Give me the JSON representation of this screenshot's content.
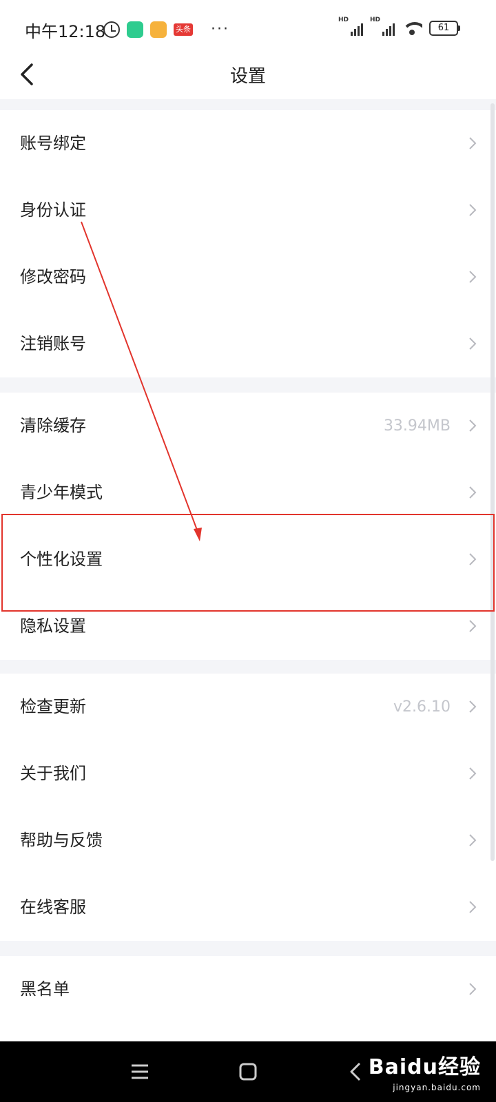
{
  "status_bar": {
    "time": "中午12:18",
    "toutiao_badge": "头条",
    "more": "···",
    "signal_1_label": "HD",
    "signal_2_label": "HD",
    "battery": "61"
  },
  "header": {
    "title": "设置"
  },
  "sections": [
    {
      "items": [
        {
          "label": "账号绑定",
          "value": ""
        },
        {
          "label": "身份认证",
          "value": ""
        },
        {
          "label": "修改密码",
          "value": ""
        },
        {
          "label": "注销账号",
          "value": ""
        }
      ]
    },
    {
      "items": [
        {
          "label": "清除缓存",
          "value": "33.94MB"
        },
        {
          "label": "青少年模式",
          "value": ""
        },
        {
          "label": "个性化设置",
          "value": ""
        },
        {
          "label": "隐私设置",
          "value": ""
        }
      ]
    },
    {
      "items": [
        {
          "label": "检查更新",
          "value": "v2.6.10"
        },
        {
          "label": "关于我们",
          "value": ""
        },
        {
          "label": "帮助与反馈",
          "value": ""
        },
        {
          "label": "在线客服",
          "value": ""
        }
      ]
    },
    {
      "items": [
        {
          "label": "黑名单",
          "value": ""
        }
      ]
    }
  ],
  "watermark": {
    "brand": "Baidu经验",
    "url": "jingyan.baidu.com"
  },
  "colors": {
    "annotation": "#e2342c",
    "secondary_text": "#c4c6cc",
    "background": "#f4f5f8"
  }
}
